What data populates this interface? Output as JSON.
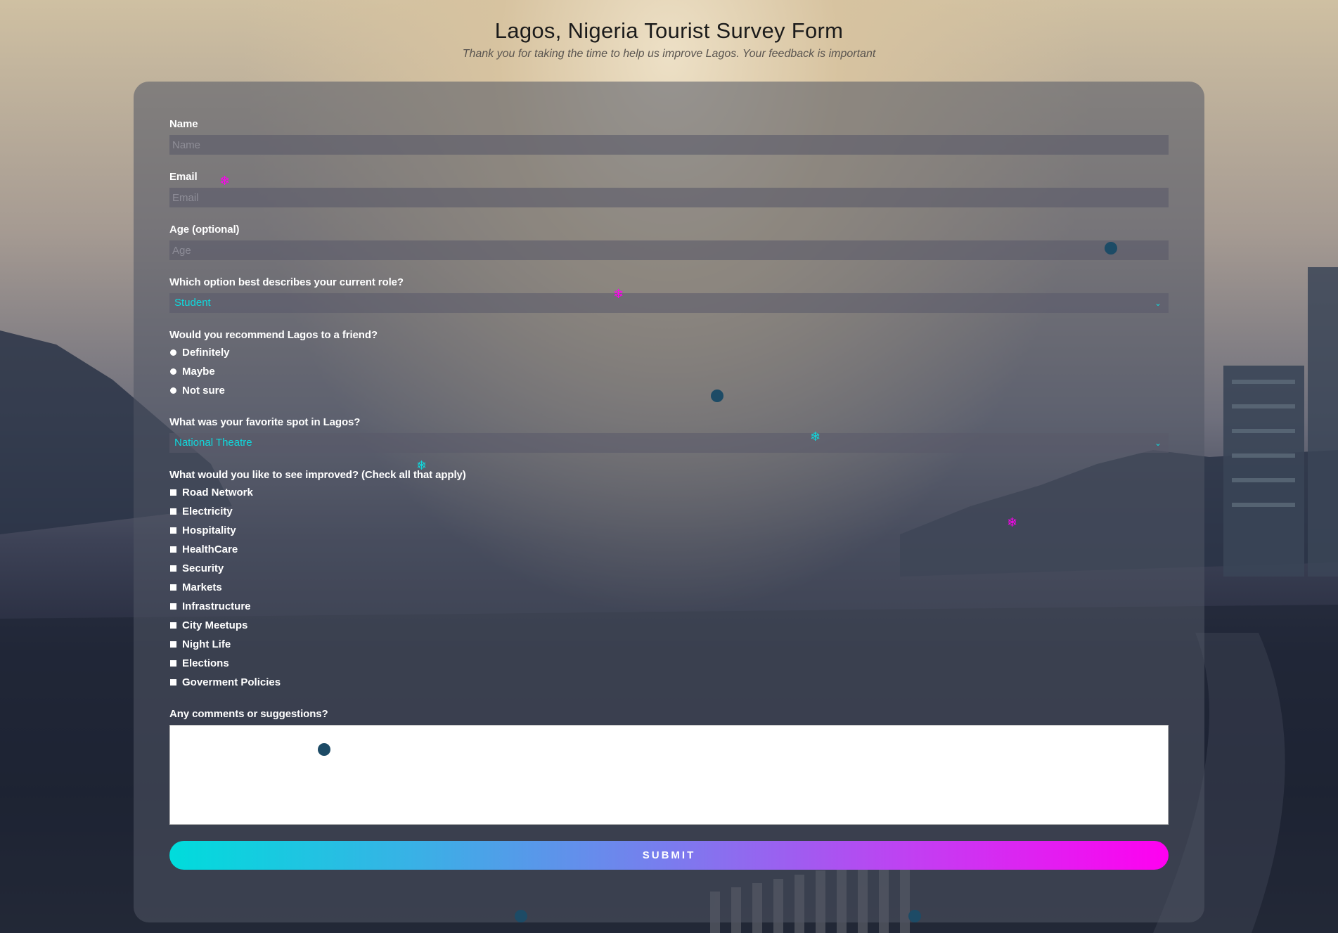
{
  "header": {
    "title": "Lagos, Nigeria Tourist Survey Form",
    "subtitle": "Thank you for taking the time to help us improve Lagos. Your feedback is important"
  },
  "form": {
    "name": {
      "label": "Name",
      "placeholder": "Name"
    },
    "email": {
      "label": "Email",
      "placeholder": "Email"
    },
    "age": {
      "label": "Age (optional)",
      "placeholder": "Age"
    },
    "role": {
      "label": "Which option best describes your current role?",
      "selected": "Student"
    },
    "recommend": {
      "label": "Would you recommend Lagos to a friend?",
      "options": [
        "Definitely",
        "Maybe",
        "Not sure"
      ]
    },
    "favorite_spot": {
      "label": "What was your favorite spot in Lagos?",
      "selected": "National Theatre"
    },
    "improvements": {
      "label": "What would you like to see improved? (Check all that apply)",
      "options": [
        "Road Network",
        "Electricity",
        "Hospitality",
        "HealthCare",
        "Security",
        "Markets",
        "Infrastructure",
        "City Meetups",
        "Night Life",
        "Elections",
        "Goverment Policies"
      ]
    },
    "comments": {
      "label": "Any comments or suggestions?"
    },
    "submit_label": "SUBMIT"
  },
  "icons": {
    "chevron": "chevron-down-icon",
    "snowflake": "snowflake-icon"
  },
  "colors": {
    "accent_cyan": "#10d8dc",
    "accent_magenta": "#ff00f0",
    "dot": "#1d4b66"
  }
}
